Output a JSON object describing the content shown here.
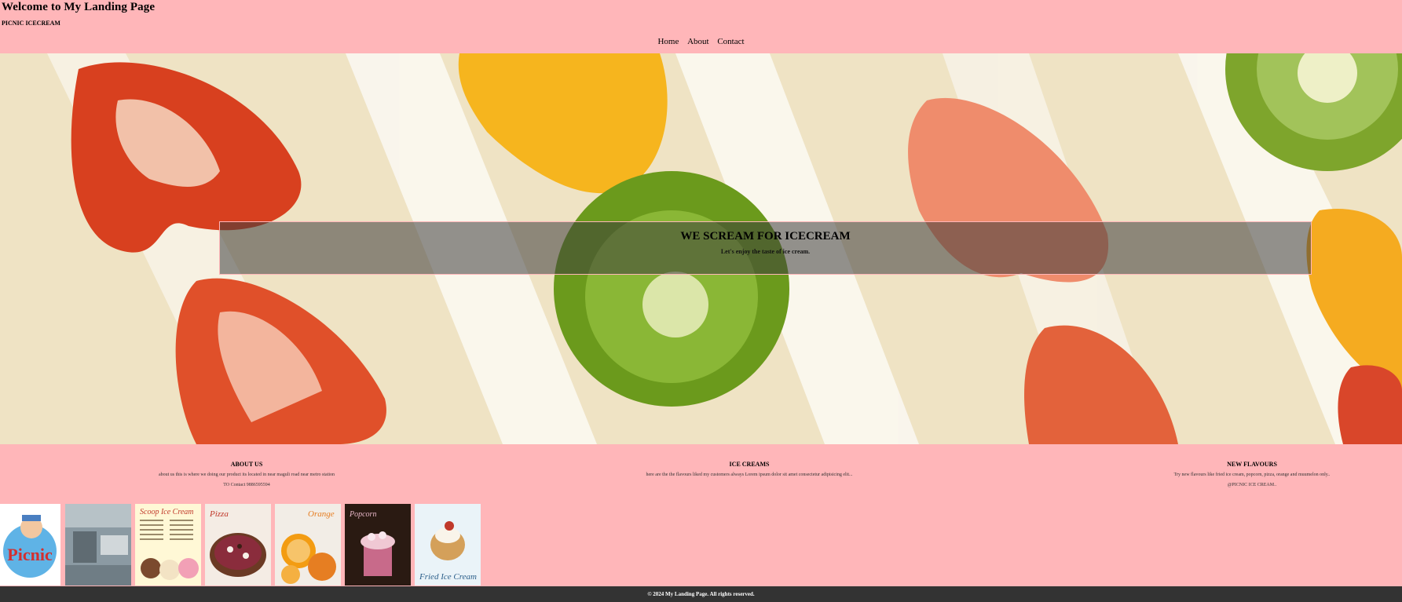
{
  "header": {
    "title": "Welcome to My Landing Page",
    "subtitle": "PICNIC ICECREAM"
  },
  "nav": {
    "items": [
      {
        "label": "Home"
      },
      {
        "label": "About"
      },
      {
        "label": "Contact"
      }
    ]
  },
  "hero": {
    "image": "fruit-sandwich-image",
    "title": "WE SCREAM FOR ICECREAM",
    "tagline": "Let's enjoy the taste of ice cream."
  },
  "columns": [
    {
      "heading": "ABOUT US",
      "lines": [
        "about us this is where we doing our product its located in near maguli road near metro station",
        "TO Contact 9886595594"
      ]
    },
    {
      "heading": "ICE CREAMS",
      "lines": [
        "here are the the flavours liked my customers always Lorem ipsum dolor sit amet consectetur adipisicing elit..."
      ]
    },
    {
      "heading": "NEW FLAVOURS",
      "lines": [
        "Try new flavours like fried ice cream, popcorn, pizza, orange and muumelon only..",
        "@PICNIC ICE CREAM.."
      ]
    }
  ],
  "gallery": [
    {
      "name": "picnic-logo-image",
      "label": "Picnic"
    },
    {
      "name": "kitchen-image"
    },
    {
      "name": "scoop-menu-image",
      "label": "Scoop Ice Cream"
    },
    {
      "name": "pizza-icecream-image",
      "label": "Pizza"
    },
    {
      "name": "orange-icecream-image",
      "label": "Orange"
    },
    {
      "name": "popcorn-icecream-image",
      "label": "Popcorn"
    },
    {
      "name": "fried-icecream-image",
      "label": "Fried Ice Cream"
    }
  ],
  "footer": {
    "text": "© 2024 My Landing Page. All rights reserved."
  },
  "colors": {
    "background": "#ffb6b9",
    "footer": "#333333",
    "overlay": "rgba(60,60,60,0.55)"
  }
}
